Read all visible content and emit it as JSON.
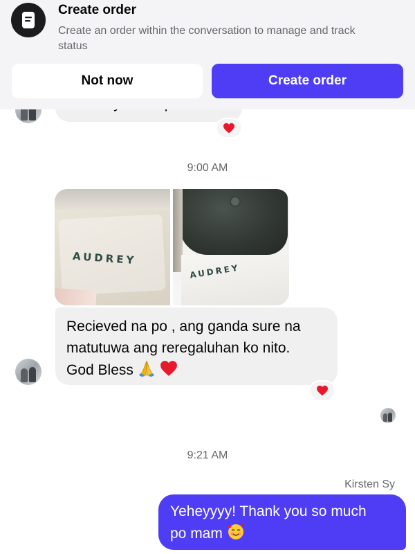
{
  "banner": {
    "title": "Create order",
    "description": "Create an order within the conversation to manage and track status",
    "icon": "order-document-icon",
    "secondary_button": "Not now",
    "primary_button": "Create order",
    "accent_color": "#4e3df5"
  },
  "messages": [
    {
      "id": "partial",
      "direction": "incoming",
      "text": "Thank you din po Mam",
      "reaction": "red-heart"
    },
    {
      "id": "photos",
      "timestamp": "9:00 AM",
      "direction": "incoming",
      "photo_labels": [
        "AUDREY",
        "AUDREY"
      ]
    },
    {
      "id": "received",
      "direction": "incoming",
      "text_lines": [
        "Recieved na po , ang ganda sure na",
        "matutuwa ang reregaluhan ko nito.",
        "God Bless"
      ],
      "emojis": [
        "folded-hands-emoji",
        "red-heart-emoji"
      ],
      "reaction": "red-heart"
    },
    {
      "id": "reply",
      "timestamp": "9:21 AM",
      "direction": "outgoing",
      "sender": "Kirsten Sy",
      "text_lines": [
        "Yeheyyyy! Thank you so much",
        "po mam"
      ],
      "emojis": [
        "smiling-face-with-hearts-emoji"
      ]
    }
  ]
}
